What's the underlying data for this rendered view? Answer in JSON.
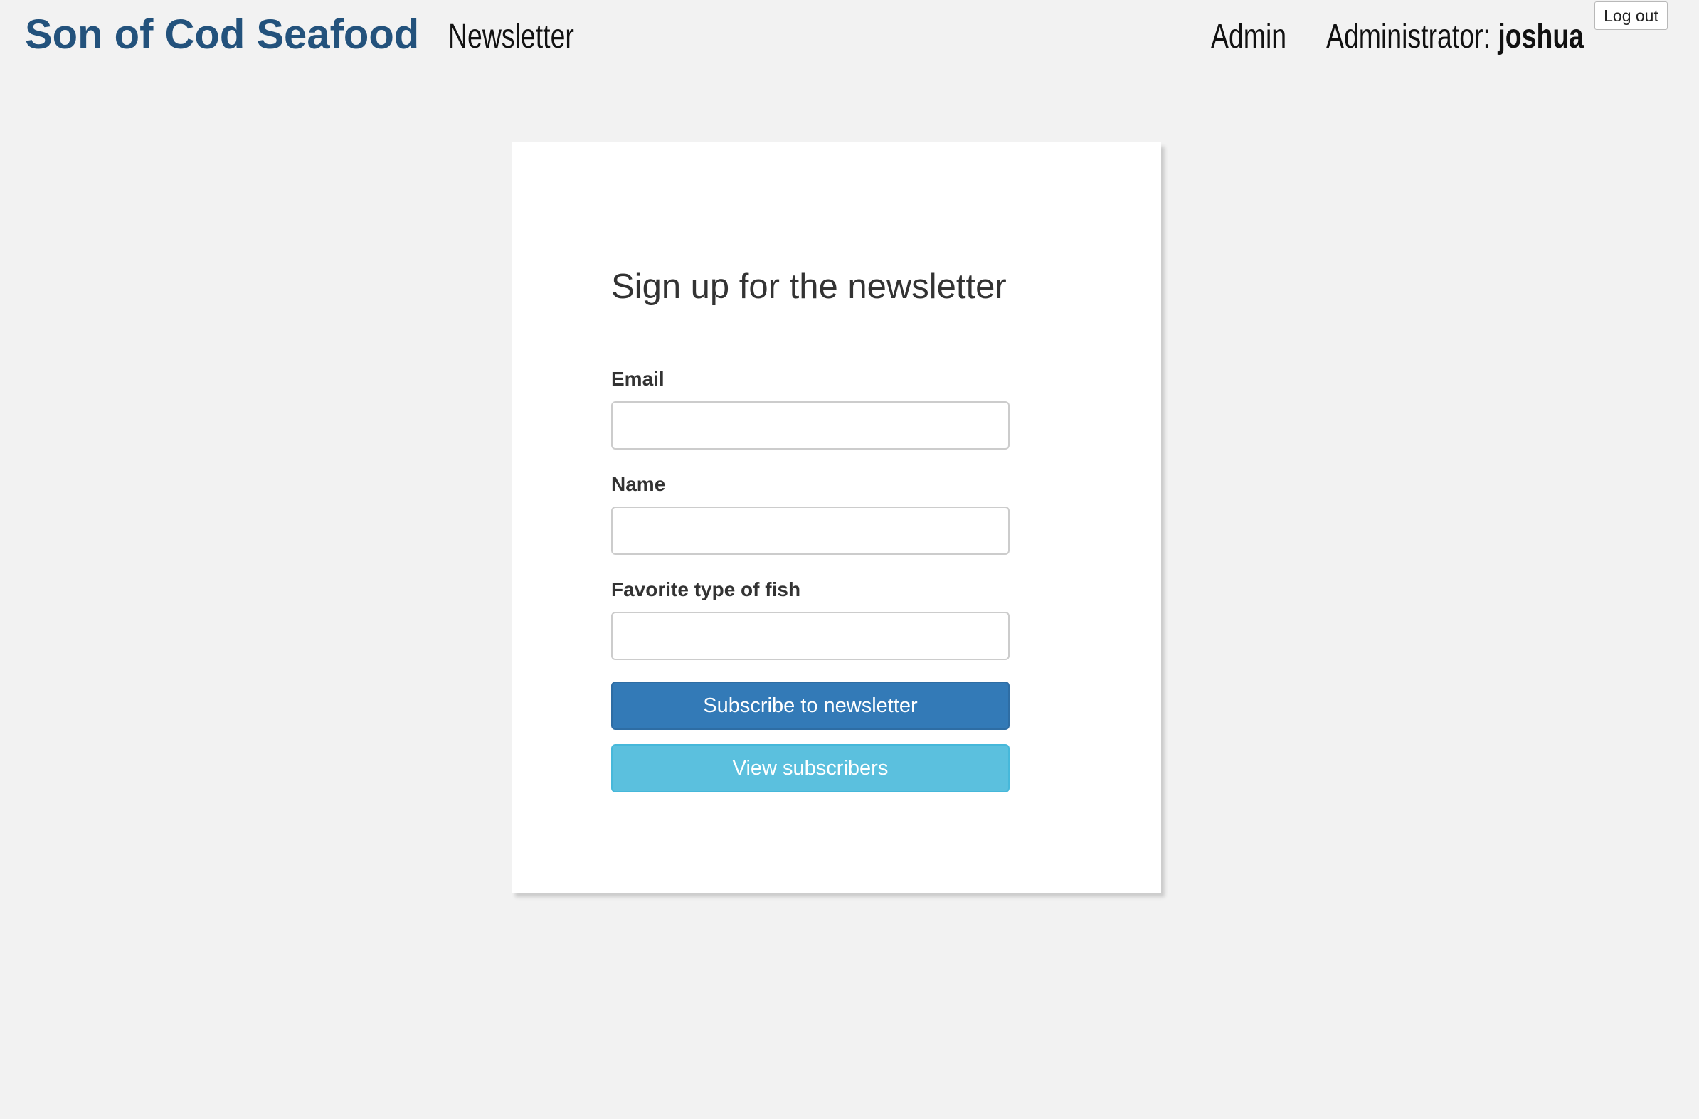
{
  "header": {
    "brand": "Son of Cod Seafood",
    "nav_newsletter": "Newsletter",
    "nav_admin": "Admin",
    "user_role_label": "Administrator: ",
    "username": "joshua",
    "logout_label": "Log out"
  },
  "form": {
    "title": "Sign up for the newsletter",
    "email_label": "Email",
    "email_value": "",
    "name_label": "Name",
    "name_value": "",
    "fish_label": "Favorite type of fish",
    "fish_value": "",
    "subscribe_label": "Subscribe to newsletter",
    "view_label": "View subscribers"
  },
  "colors": {
    "brand": "#23527c",
    "primary_button": "#337ab7",
    "info_button": "#5bc0de",
    "page_background": "#f2f2f2"
  }
}
